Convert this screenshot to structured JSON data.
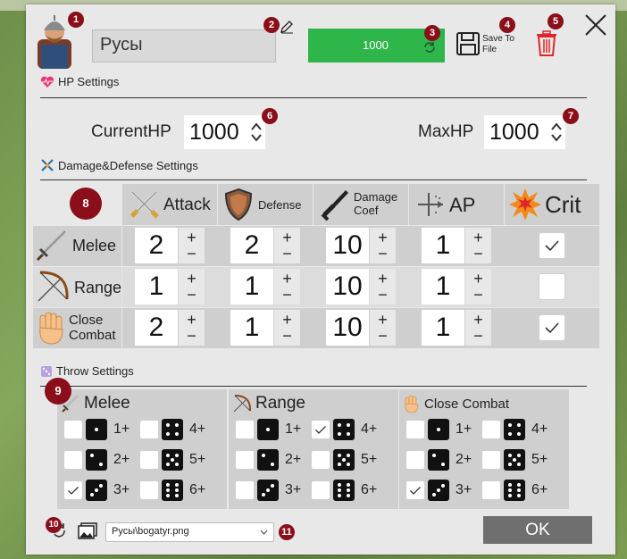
{
  "header": {
    "name_value": "Русы",
    "hp_button_value": "1000",
    "save_label": "Save To File",
    "close_glyph": "✕"
  },
  "badges": [
    "1",
    "2",
    "3",
    "4",
    "5",
    "6",
    "7",
    "8",
    "9",
    "10",
    "11"
  ],
  "hp": {
    "section_title": "HP Settings",
    "current_label": "CurrentHP",
    "current_value": "1000",
    "max_label": "MaxHP",
    "max_value": "1000"
  },
  "damage": {
    "section_title": "Damage&Defense Settings",
    "columns": [
      "Attack",
      "Defense",
      "Damage Coef",
      "AP",
      "Crit"
    ],
    "rows": [
      {
        "label": "Melee",
        "attack": "2",
        "defense": "2",
        "coef": "10",
        "ap": "1",
        "crit": true
      },
      {
        "label": "Range",
        "attack": "1",
        "defense": "1",
        "coef": "10",
        "ap": "1",
        "crit": false
      },
      {
        "label": "Close Combat",
        "attack": "2",
        "defense": "1",
        "coef": "10",
        "ap": "1",
        "crit": true
      }
    ],
    "plus": "+",
    "minus": "−"
  },
  "throw": {
    "section_title": "Throw Settings",
    "panels": [
      {
        "title": "Melee",
        "checked": [
          "3+"
        ]
      },
      {
        "title": "Range",
        "checked": [
          "4+"
        ]
      },
      {
        "title": "Close Combat",
        "checked": [
          "3+"
        ]
      }
    ],
    "dice_labels": [
      "1+",
      "2+",
      "3+",
      "4+",
      "5+",
      "6+"
    ]
  },
  "footer": {
    "image_select_value": "Русы\\bogatyr.png",
    "ok_label": "OK"
  },
  "colors": {
    "accent_green": "#2fb64a",
    "badge": "#8b0f1a",
    "delete_red": "#e0262a"
  }
}
